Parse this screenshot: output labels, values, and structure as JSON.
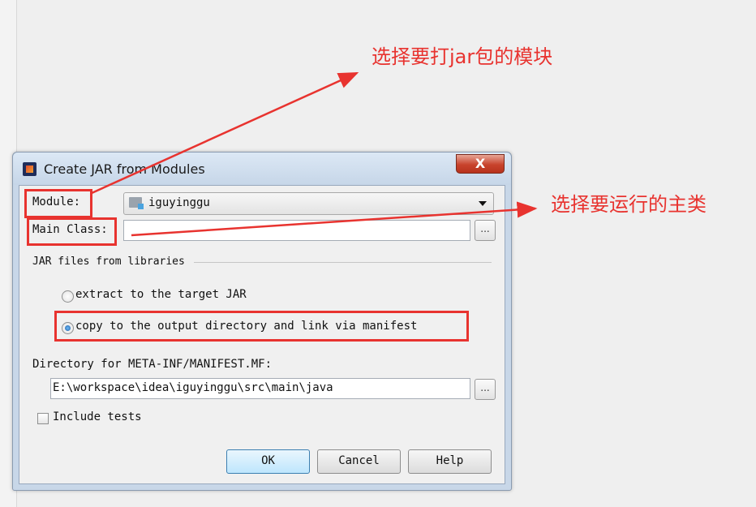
{
  "annotations": {
    "select_module": "选择要打jar包的模块",
    "select_main_class": "选择要运行的主类",
    "color": "#e8332f"
  },
  "dialog": {
    "title": "Create JAR from Modules",
    "close_label": "X",
    "module": {
      "label": "Module:",
      "selected": "iguyinggu"
    },
    "main_class": {
      "label": "Main Class:",
      "value": "",
      "browse_label": "..."
    },
    "jar_files_section": {
      "title": "JAR files from libraries",
      "options": [
        {
          "label": "extract to the target JAR",
          "selected": false
        },
        {
          "label": "copy to the output directory and link via manifest",
          "selected": true
        }
      ]
    },
    "manifest_dir": {
      "label": "Directory for META-INF/MANIFEST.MF:",
      "value": "E:\\workspace\\idea\\iguyinggu\\src\\main\\java",
      "browse_label": "..."
    },
    "include_tests": {
      "label": "Include tests",
      "checked": false
    },
    "buttons": {
      "ok": "OK",
      "cancel": "Cancel",
      "help": "Help"
    }
  }
}
